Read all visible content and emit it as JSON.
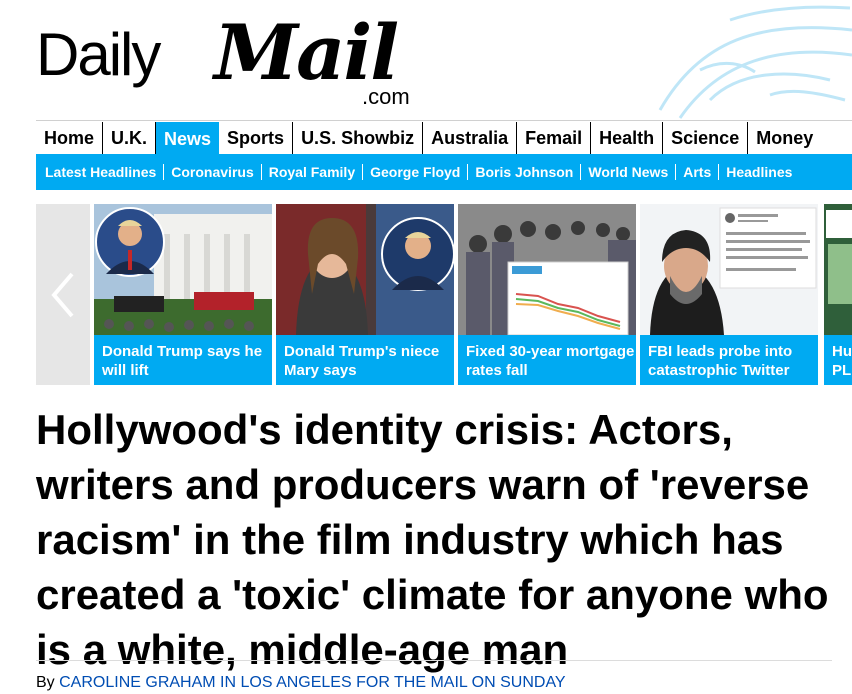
{
  "brand": {
    "daily": "Daily",
    "mail": "Mail",
    "dotcom": ".com"
  },
  "primary_nav": [
    "Home",
    "U.K.",
    "News",
    "Sports",
    "U.S. Showbiz",
    "Australia",
    "Femail",
    "Health",
    "Science",
    "Money"
  ],
  "primary_nav_active": "News",
  "secondary_nav": [
    "Latest Headlines",
    "Coronavirus",
    "Royal Family",
    "George Floyd",
    "Boris Johnson",
    "World News",
    "Arts",
    "Headlines"
  ],
  "carousel": {
    "prev_icon": "chevron-left-icon",
    "cards": [
      {
        "caption": "Donald Trump says he will lift"
      },
      {
        "caption": "Donald Trump's niece Mary says"
      },
      {
        "caption": "Fixed 30-year mortgage rates fall"
      },
      {
        "caption": "FBI leads probe into catastrophic Twitter"
      },
      {
        "caption": "Hu PL"
      }
    ]
  },
  "article": {
    "headline": "Hollywood's identity crisis: Actors, writers and producers warn of 'reverse racism' in the film industry which has created a 'toxic' climate for anyone who is a white, middle-age man",
    "byline_prefix": "By",
    "byline_author": "CAROLINE GRAHAM IN LOS ANGELES FOR THE MAIL ON SUNDAY"
  },
  "colors": {
    "accent": "#00aaf2",
    "byline_link": "#004db3"
  }
}
